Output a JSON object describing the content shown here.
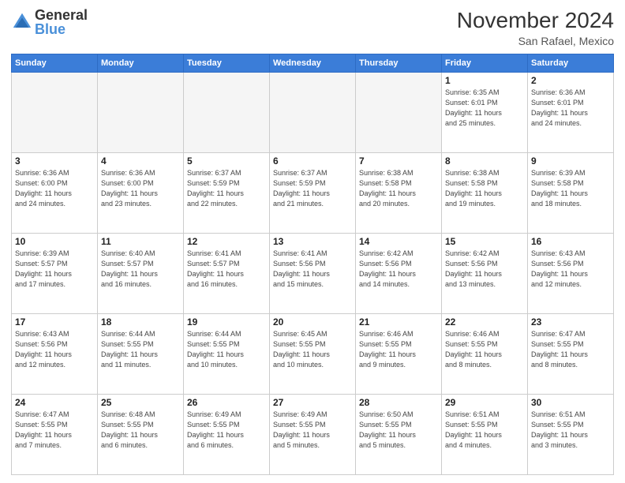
{
  "header": {
    "logo_general": "General",
    "logo_blue": "Blue",
    "month": "November 2024",
    "location": "San Rafael, Mexico"
  },
  "days_of_week": [
    "Sunday",
    "Monday",
    "Tuesday",
    "Wednesday",
    "Thursday",
    "Friday",
    "Saturday"
  ],
  "weeks": [
    [
      {
        "day": "",
        "info": ""
      },
      {
        "day": "",
        "info": ""
      },
      {
        "day": "",
        "info": ""
      },
      {
        "day": "",
        "info": ""
      },
      {
        "day": "",
        "info": ""
      },
      {
        "day": "1",
        "info": "Sunrise: 6:35 AM\nSunset: 6:01 PM\nDaylight: 11 hours\nand 25 minutes."
      },
      {
        "day": "2",
        "info": "Sunrise: 6:36 AM\nSunset: 6:01 PM\nDaylight: 11 hours\nand 24 minutes."
      }
    ],
    [
      {
        "day": "3",
        "info": "Sunrise: 6:36 AM\nSunset: 6:00 PM\nDaylight: 11 hours\nand 24 minutes."
      },
      {
        "day": "4",
        "info": "Sunrise: 6:36 AM\nSunset: 6:00 PM\nDaylight: 11 hours\nand 23 minutes."
      },
      {
        "day": "5",
        "info": "Sunrise: 6:37 AM\nSunset: 5:59 PM\nDaylight: 11 hours\nand 22 minutes."
      },
      {
        "day": "6",
        "info": "Sunrise: 6:37 AM\nSunset: 5:59 PM\nDaylight: 11 hours\nand 21 minutes."
      },
      {
        "day": "7",
        "info": "Sunrise: 6:38 AM\nSunset: 5:58 PM\nDaylight: 11 hours\nand 20 minutes."
      },
      {
        "day": "8",
        "info": "Sunrise: 6:38 AM\nSunset: 5:58 PM\nDaylight: 11 hours\nand 19 minutes."
      },
      {
        "day": "9",
        "info": "Sunrise: 6:39 AM\nSunset: 5:58 PM\nDaylight: 11 hours\nand 18 minutes."
      }
    ],
    [
      {
        "day": "10",
        "info": "Sunrise: 6:39 AM\nSunset: 5:57 PM\nDaylight: 11 hours\nand 17 minutes."
      },
      {
        "day": "11",
        "info": "Sunrise: 6:40 AM\nSunset: 5:57 PM\nDaylight: 11 hours\nand 16 minutes."
      },
      {
        "day": "12",
        "info": "Sunrise: 6:41 AM\nSunset: 5:57 PM\nDaylight: 11 hours\nand 16 minutes."
      },
      {
        "day": "13",
        "info": "Sunrise: 6:41 AM\nSunset: 5:56 PM\nDaylight: 11 hours\nand 15 minutes."
      },
      {
        "day": "14",
        "info": "Sunrise: 6:42 AM\nSunset: 5:56 PM\nDaylight: 11 hours\nand 14 minutes."
      },
      {
        "day": "15",
        "info": "Sunrise: 6:42 AM\nSunset: 5:56 PM\nDaylight: 11 hours\nand 13 minutes."
      },
      {
        "day": "16",
        "info": "Sunrise: 6:43 AM\nSunset: 5:56 PM\nDaylight: 11 hours\nand 12 minutes."
      }
    ],
    [
      {
        "day": "17",
        "info": "Sunrise: 6:43 AM\nSunset: 5:56 PM\nDaylight: 11 hours\nand 12 minutes."
      },
      {
        "day": "18",
        "info": "Sunrise: 6:44 AM\nSunset: 5:55 PM\nDaylight: 11 hours\nand 11 minutes."
      },
      {
        "day": "19",
        "info": "Sunrise: 6:44 AM\nSunset: 5:55 PM\nDaylight: 11 hours\nand 10 minutes."
      },
      {
        "day": "20",
        "info": "Sunrise: 6:45 AM\nSunset: 5:55 PM\nDaylight: 11 hours\nand 10 minutes."
      },
      {
        "day": "21",
        "info": "Sunrise: 6:46 AM\nSunset: 5:55 PM\nDaylight: 11 hours\nand 9 minutes."
      },
      {
        "day": "22",
        "info": "Sunrise: 6:46 AM\nSunset: 5:55 PM\nDaylight: 11 hours\nand 8 minutes."
      },
      {
        "day": "23",
        "info": "Sunrise: 6:47 AM\nSunset: 5:55 PM\nDaylight: 11 hours\nand 8 minutes."
      }
    ],
    [
      {
        "day": "24",
        "info": "Sunrise: 6:47 AM\nSunset: 5:55 PM\nDaylight: 11 hours\nand 7 minutes."
      },
      {
        "day": "25",
        "info": "Sunrise: 6:48 AM\nSunset: 5:55 PM\nDaylight: 11 hours\nand 6 minutes."
      },
      {
        "day": "26",
        "info": "Sunrise: 6:49 AM\nSunset: 5:55 PM\nDaylight: 11 hours\nand 6 minutes."
      },
      {
        "day": "27",
        "info": "Sunrise: 6:49 AM\nSunset: 5:55 PM\nDaylight: 11 hours\nand 5 minutes."
      },
      {
        "day": "28",
        "info": "Sunrise: 6:50 AM\nSunset: 5:55 PM\nDaylight: 11 hours\nand 5 minutes."
      },
      {
        "day": "29",
        "info": "Sunrise: 6:51 AM\nSunset: 5:55 PM\nDaylight: 11 hours\nand 4 minutes."
      },
      {
        "day": "30",
        "info": "Sunrise: 6:51 AM\nSunset: 5:55 PM\nDaylight: 11 hours\nand 3 minutes."
      }
    ]
  ]
}
